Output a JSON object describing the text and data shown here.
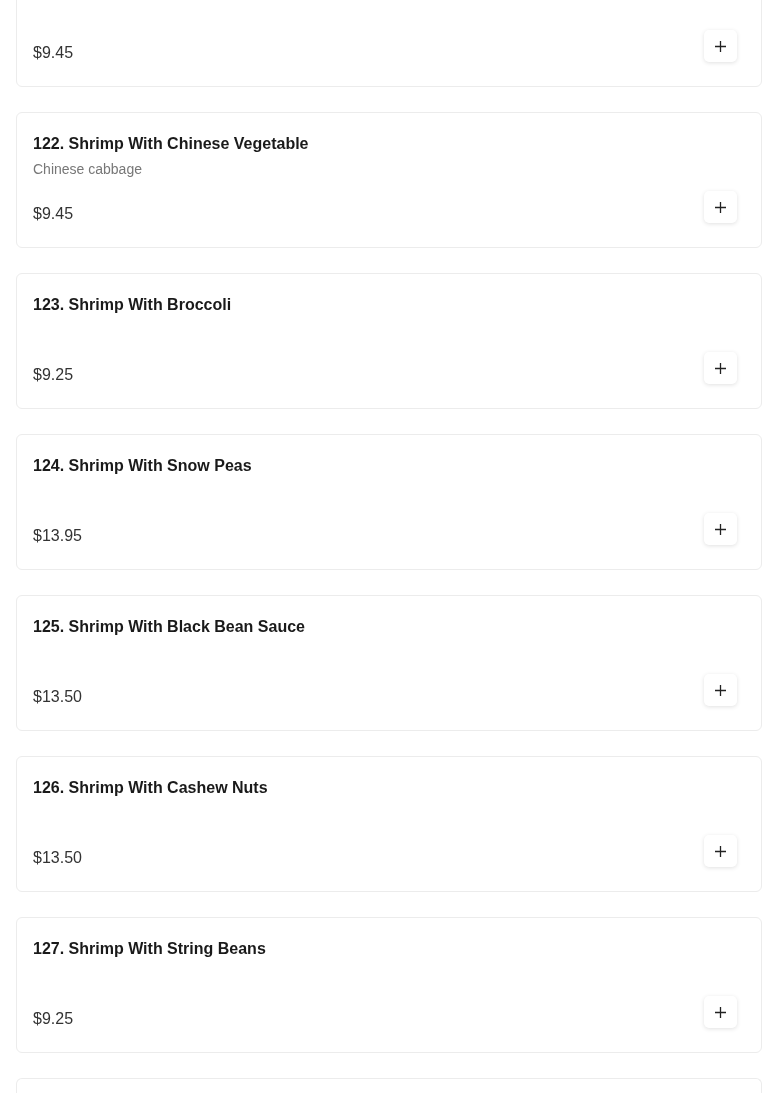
{
  "menu_items": [
    {
      "price": "$9.45"
    },
    {
      "title": "122. Shrimp With Chinese Vegetable",
      "description": "Chinese cabbage",
      "price": "$9.45"
    },
    {
      "title": "123. Shrimp With Broccoli",
      "price": "$9.25"
    },
    {
      "title": "124. Shrimp With Snow Peas",
      "price": "$13.95"
    },
    {
      "title": "125. Shrimp With Black Bean Sauce",
      "price": "$13.50"
    },
    {
      "title": "126. Shrimp With Cashew Nuts",
      "price": "$13.50"
    },
    {
      "title": "127. Shrimp With String Beans",
      "price": "$9.25"
    }
  ],
  "next_card_partly_visible": true
}
